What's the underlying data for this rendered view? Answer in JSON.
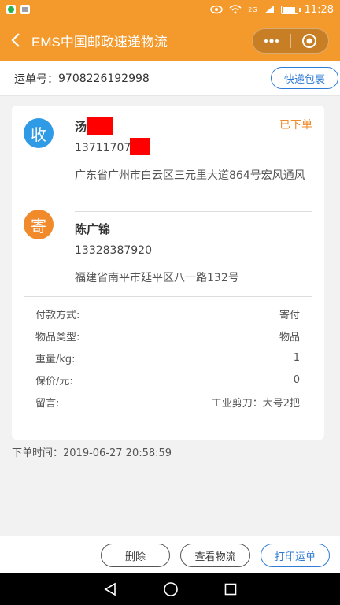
{
  "statusbar": {
    "time": "11:28",
    "network": "2G"
  },
  "nav": {
    "title": "EMS中国邮政速递物流"
  },
  "waybill": {
    "label": "运单号：",
    "number": "9708226192998",
    "quick_button": "快递包裹"
  },
  "receiver": {
    "badge": "收",
    "name": "汤",
    "phone": "13711707",
    "address": "广东省广州市白云区三元里大道864号宏风通风"
  },
  "order_status": "已下单",
  "sender": {
    "badge": "寄",
    "name": "陈广锦",
    "phone": "13328387920",
    "address": "福建省南平市延平区八一路132号"
  },
  "details": [
    {
      "label": "付款方式:",
      "value": "寄付"
    },
    {
      "label": "物品类型:",
      "value": "物品"
    },
    {
      "label": "重量/kg:",
      "value": "1"
    },
    {
      "label": "保价/元:",
      "value": "0"
    },
    {
      "label": "留言:",
      "value": "工业剪刀：大号2把"
    }
  ],
  "order_time": "下单时间：2019-06-27 20:58:59",
  "actions": {
    "delete": "删除",
    "track": "查看物流",
    "print": "打印运单"
  },
  "colors": {
    "header": "#f49a2c",
    "receiver_badge": "#2f9ae6",
    "sender_badge": "#f08a2a",
    "primary": "#2d7bd6",
    "redaction": "#ff0000"
  }
}
